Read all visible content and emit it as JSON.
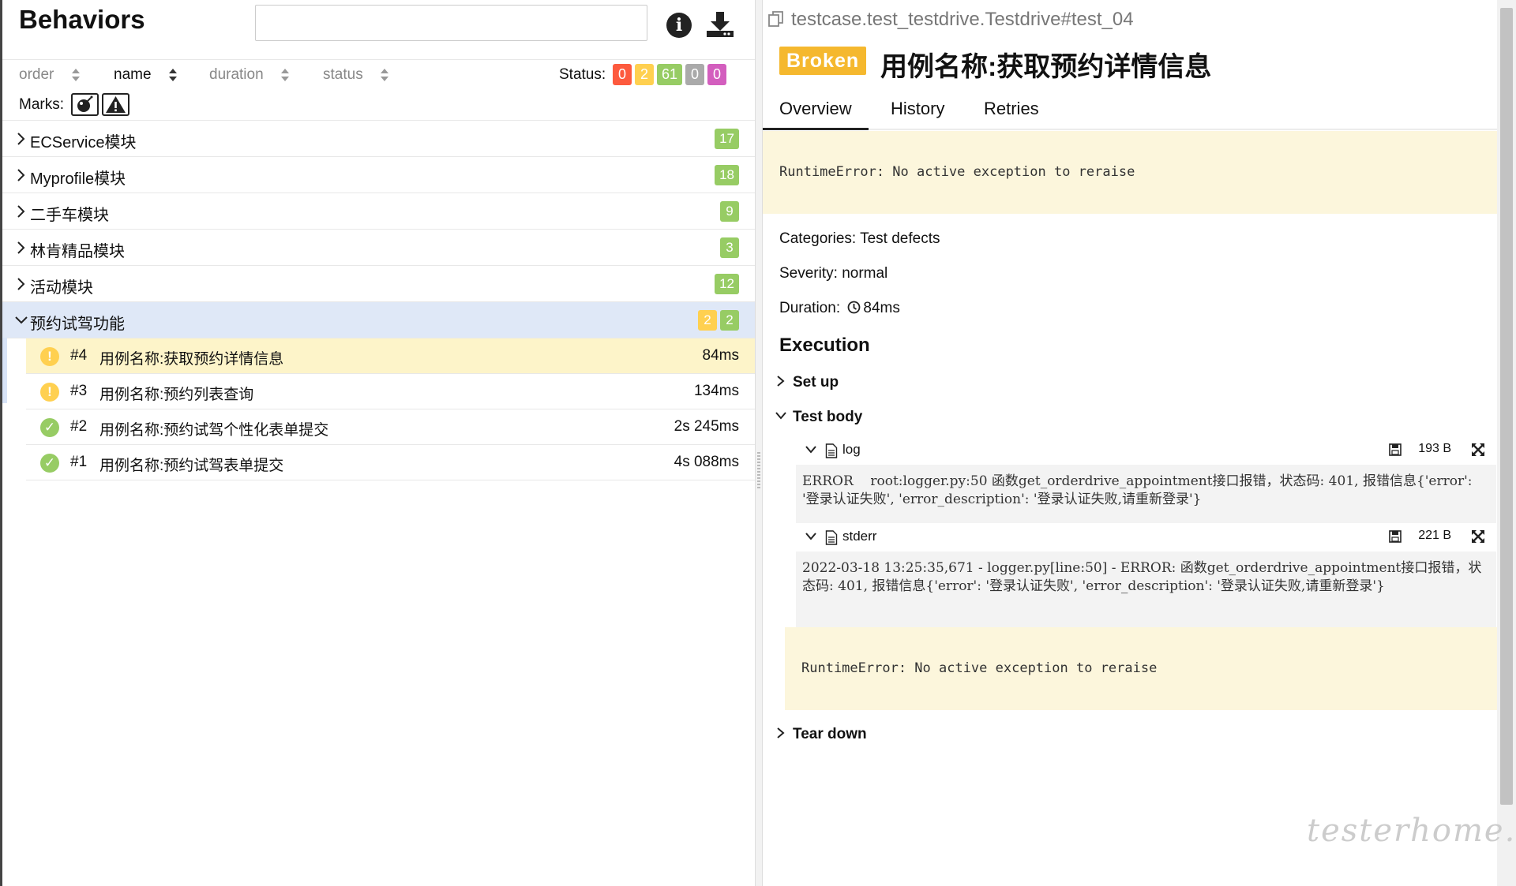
{
  "left": {
    "title": "Behaviors",
    "search": {
      "value": "",
      "placeholder": ""
    },
    "sort": [
      {
        "label": "order",
        "active": false
      },
      {
        "label": "name",
        "active": true
      },
      {
        "label": "duration",
        "active": false
      },
      {
        "label": "status",
        "active": false
      }
    ],
    "status_label": "Status:",
    "status_counts": [
      {
        "value": "0",
        "color": "#fd5a3e"
      },
      {
        "value": "2",
        "color": "#ffd050"
      },
      {
        "value": "61",
        "color": "#97cc64"
      },
      {
        "value": "0",
        "color": "#aaaaaa"
      },
      {
        "value": "0",
        "color": "#d35ebe"
      }
    ],
    "marks_label": "Marks:",
    "groups": [
      {
        "label": "ECService模块",
        "counts": [
          {
            "value": "17",
            "color": "#97cc64"
          }
        ]
      },
      {
        "label": "Myprofile模块",
        "counts": [
          {
            "value": "18",
            "color": "#97cc64"
          }
        ]
      },
      {
        "label": "二手车模块",
        "counts": [
          {
            "value": "9",
            "color": "#97cc64"
          }
        ]
      },
      {
        "label": "林肯精品模块",
        "counts": [
          {
            "value": "3",
            "color": "#97cc64"
          }
        ]
      },
      {
        "label": "活动模块",
        "counts": [
          {
            "value": "12",
            "color": "#97cc64"
          }
        ]
      },
      {
        "label": "预约试驾功能",
        "counts": [
          {
            "value": "2",
            "color": "#ffd050"
          },
          {
            "value": "2",
            "color": "#97cc64"
          }
        ]
      }
    ],
    "cases": [
      {
        "num": "#4",
        "name": "用例名称:获取预约详情信息",
        "duration": "84ms",
        "status": "broken"
      },
      {
        "num": "#3",
        "name": "用例名称:预约列表查询",
        "duration": "134ms",
        "status": "broken"
      },
      {
        "num": "#2",
        "name": "用例名称:预约试驾个性化表单提交",
        "duration": "2s 245ms",
        "status": "passed"
      },
      {
        "num": "#1",
        "name": "用例名称:预约试驾表单提交",
        "duration": "4s 088ms",
        "status": "passed"
      }
    ]
  },
  "right": {
    "uid": "testcase.test_testdrive.Testdrive#test_04",
    "status_badge": "Broken",
    "title": "用例名称:获取预约详情信息",
    "tabs": [
      "Overview",
      "History",
      "Retries"
    ],
    "error_message": "RuntimeError: No active exception to reraise",
    "categories": "Categories: Test defects",
    "severity": "Severity: normal",
    "duration_label": "Duration:",
    "duration_value": "84ms",
    "execution_title": "Execution",
    "steps": {
      "setup": "Set up",
      "body": "Test body",
      "teardown": "Tear down"
    },
    "attachments": [
      {
        "name": "log",
        "size": "193 B",
        "content": "ERROR    root:logger.py:50 函数get_orderdrive_appointment接口报错，状态码: 401, 报错信息{'error': '登录认证失败', 'error_description': '登录认证失败,请重新登录'}"
      },
      {
        "name": "stderr",
        "size": "221 B",
        "content": "2022-03-18 13:25:35,671 - logger.py[line:50] - ERROR: 函数get_orderdrive_appointment接口报错，状态码: 401, 报错信息{'error': '登录认证失败', 'error_description': '登录认证失败,请重新登录'}"
      }
    ],
    "inner_error_message": "RuntimeError: No active exception to reraise"
  },
  "watermark": "testerhome.com",
  "colors": {
    "broken": "#ffd050",
    "passed": "#97cc64",
    "selected_row": "#fdf4c9",
    "expanded_group": "#dfe8f7"
  }
}
